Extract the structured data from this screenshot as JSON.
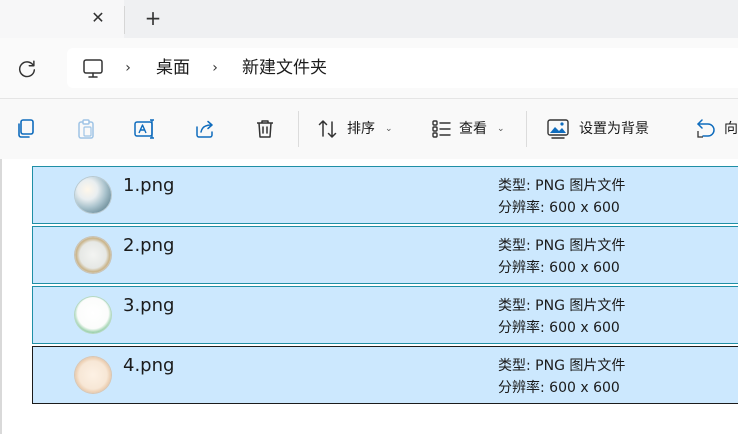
{
  "tabbar": {
    "close_icon": "close-icon",
    "new_tab_icon": "plus-icon"
  },
  "addressbar": {
    "breadcrumb": [
      "桌面",
      "新建文件夹"
    ],
    "separator": "›"
  },
  "toolbar": {
    "sort_label": "排序",
    "view_label": "查看",
    "set_background_label": "设置为背景",
    "rotate_label": "向"
  },
  "files": [
    {
      "name": "1.png",
      "type": "类型: PNG 图片文件",
      "resolution": "分辨率: 600 x 600"
    },
    {
      "name": "2.png",
      "type": "类型: PNG 图片文件",
      "resolution": "分辨率: 600 x 600"
    },
    {
      "name": "3.png",
      "type": "类型: PNG 图片文件",
      "resolution": "分辨率: 600 x 600"
    },
    {
      "name": "4.png",
      "type": "类型: PNG 图片文件",
      "resolution": "分辨率: 600 x 600"
    }
  ],
  "colors": {
    "accent": "#1f8fa6",
    "selection": "#cce8fe",
    "icon_blue": "#0f6cbd"
  }
}
